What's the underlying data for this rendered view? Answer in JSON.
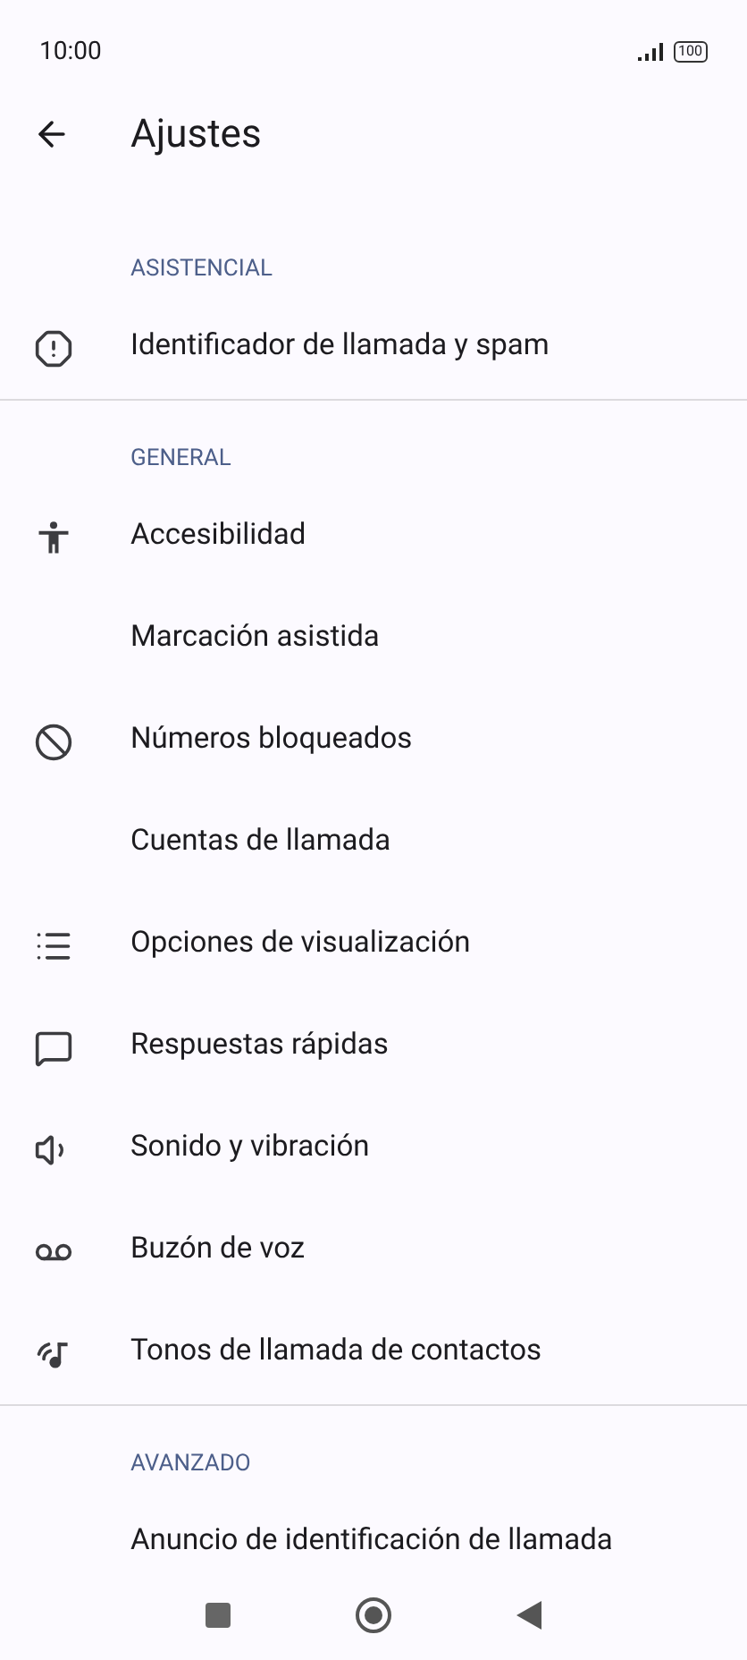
{
  "status_bar": {
    "time": "10:00",
    "battery": "100"
  },
  "header": {
    "title": "Ajustes"
  },
  "sections": [
    {
      "title": "ASISTENCIAL",
      "items": [
        {
          "label": "Identificador de llamada y spam",
          "kind": "alert"
        }
      ]
    },
    {
      "title": "GENERAL",
      "items": [
        {
          "label": "Accesibilidad",
          "kind": "person"
        },
        {
          "label": "Marcación asistida"
        },
        {
          "label": "Números bloqueados",
          "kind": "block"
        },
        {
          "label": "Cuentas de llamada"
        },
        {
          "label": "Opciones de visualización",
          "kind": "list"
        },
        {
          "label": "Respuestas rápidas",
          "kind": "message"
        },
        {
          "label": "Sonido y vibración",
          "kind": "volume"
        },
        {
          "label": "Buzón de voz",
          "kind": "voicemail"
        },
        {
          "label": "Tonos de llamada de contactos",
          "kind": "ringtone"
        }
      ]
    },
    {
      "title": "AVANZADO",
      "items": [
        {
          "label": "Anuncio de identificación de llamada"
        }
      ]
    }
  ]
}
